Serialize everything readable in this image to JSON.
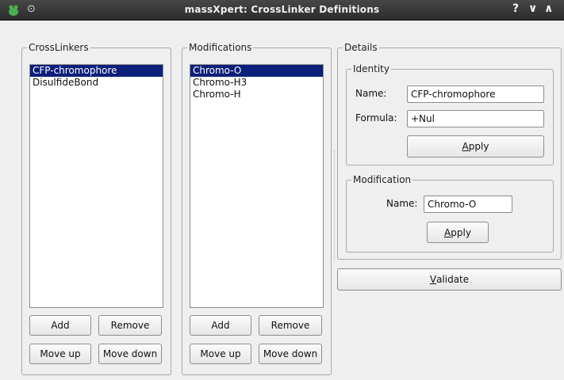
{
  "window": {
    "title": "massXpert: CrossLinker Definitions",
    "controls": [
      "?",
      "∨",
      "∧"
    ]
  },
  "crosslinkers": {
    "group_label": "CrossLinkers",
    "items": [
      {
        "label": "CFP-chromophore",
        "selected": true
      },
      {
        "label": "DisulfideBond",
        "selected": false
      }
    ],
    "add_label": "Add",
    "remove_label": "Remove",
    "move_up_label": "Move up",
    "move_down_label": "Move down"
  },
  "modifications": {
    "group_label": "Modifications",
    "items": [
      {
        "label": "Chromo-O",
        "selected": true
      },
      {
        "label": "Chromo-H3",
        "selected": false
      },
      {
        "label": "Chromo-H",
        "selected": false
      }
    ],
    "add_label": "Add",
    "remove_label": "Remove",
    "move_up_label": "Move up",
    "move_down_label": "Move down"
  },
  "details": {
    "group_label": "Details",
    "identity": {
      "group_label": "Identity",
      "name_label": "Name:",
      "name_value": "CFP-chromophore",
      "formula_label": "Formula:",
      "formula_value": "+Nul",
      "apply_mnemonic": "A",
      "apply_rest": "pply"
    },
    "modification": {
      "group_label": "Modification",
      "name_label": "Name:",
      "name_value": "Chromo-O",
      "apply_mnemonic": "A",
      "apply_rest": "pply"
    }
  },
  "validate": {
    "mnemonic": "V",
    "rest": "alidate"
  },
  "colors": {
    "selection": "#0c1f7a",
    "titlebar": "#333333",
    "window_bg": "#efefef"
  }
}
